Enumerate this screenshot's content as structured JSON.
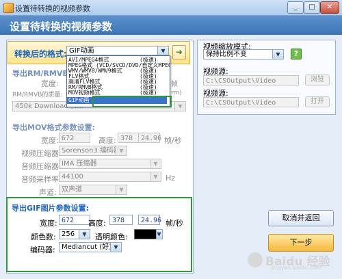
{
  "window": {
    "title": "设置待转换的视频参数",
    "controls": [
      "_",
      "□",
      "✕"
    ]
  },
  "header": {
    "title": "设置待转换的视频参数"
  },
  "output_format": {
    "label": "转换后的格式:",
    "selected": "GIF动画",
    "options": [
      {
        "name": "AVI/MPEG4格式",
        "note": "(极速)"
      },
      {
        "name": "MPEG格式 (VCD/SVCD/DVD/自定义MPEG)",
        "note": ""
      },
      {
        "name": "WMV/WMV8/WMV9格式",
        "note": "(极速)"
      },
      {
        "name": "FLV格式",
        "note": "(极速)"
      },
      {
        "name": "高清FLV格式",
        "note": "(极速)"
      },
      {
        "name": "RM/RMVB格式",
        "note": "(极速)"
      },
      {
        "name": "MOV视频格式",
        "note": "(极速)"
      },
      {
        "name": "GIF动画",
        "note": ""
      }
    ]
  },
  "rm_section": {
    "title": "导出RM/RMVB格式",
    "width_label": "宽度:",
    "quality_label": "RM/RMVB的质量:",
    "quality_value": "450k Download (V...",
    "right_fragment": "rm)",
    "height_fragment": "帧"
  },
  "mov_section": {
    "title": "导出MOV格式参数设置:",
    "width_label": "宽度:",
    "width_value": "672",
    "height_label": "高度:",
    "height_value": "378",
    "fps_value": "24.96",
    "fps_unit": "帧/秒",
    "video_codec_label": "视频压缩器:",
    "video_codec_value": "Sorenson3 编码器",
    "audio_codec_label": "音频压缩器:",
    "audio_codec_value": "IMA 压缩器",
    "sample_rate_label": "音频采样率:",
    "sample_rate_value": "44100",
    "sample_rate_unit": "Hz",
    "channels_label": "声道:",
    "channels_value": "双声道"
  },
  "gif_section": {
    "title": "导出GIF图片参数设置:",
    "width_label": "宽度:",
    "width_value": "672",
    "height_label": "高度:",
    "height_value": "378",
    "fps_value": "24.96",
    "fps_unit": "帧/秒",
    "colors_label": "颜色数:",
    "colors_value": "256",
    "transparent_label": "透明颜色:",
    "encoder_label": "编码器:",
    "encoder_value": "Mediancut (好)"
  },
  "right_panel": {
    "scale_label": "视频缩放模式:",
    "scale_value": "保持比例不变",
    "help": "?",
    "source_label": "视频源:",
    "source_value": "C:\\CSOutput\\Video",
    "browse_label": "浏览",
    "source2_label": "视频源:",
    "source2_value": "C:\\CSOutput\\Video",
    "open_label": "打开"
  },
  "buttons": {
    "cancel": "取消并返回",
    "next": "下一步"
  },
  "watermark": {
    "brand": "Baidu 经验",
    "url": "jingyan.baidu.com"
  },
  "colors": {
    "accent_green": "#2e9b3a",
    "header_blue": "#3b74b6",
    "label_blue": "#1c63c7",
    "selection_blue": "#3874c9"
  }
}
